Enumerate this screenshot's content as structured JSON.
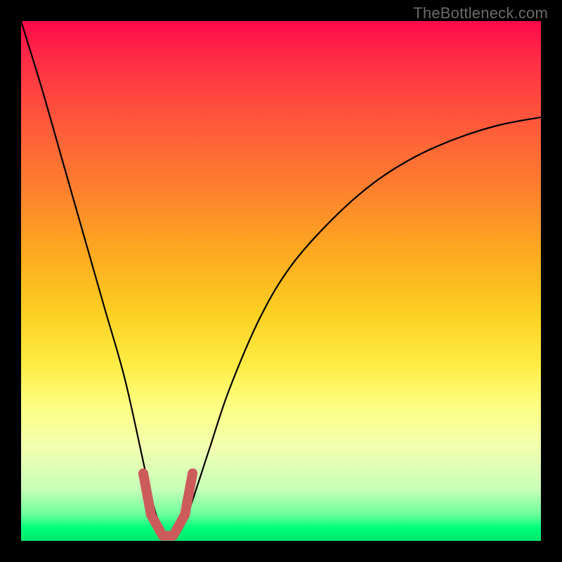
{
  "watermark": "TheBottleneck.com",
  "chart_data": {
    "type": "line",
    "title": "",
    "xlabel": "",
    "ylabel": "",
    "xlim": [
      0,
      100
    ],
    "ylim": [
      0,
      100
    ],
    "grid": false,
    "series": [
      {
        "name": "bottleneck-curve",
        "x": [
          0,
          4,
          8,
          12,
          16,
          20,
          24,
          26,
          28,
          30,
          32,
          36,
          40,
          46,
          52,
          60,
          68,
          76,
          84,
          92,
          100
        ],
        "y": [
          100,
          87,
          73,
          59,
          45,
          31,
          13,
          5,
          1,
          1,
          5,
          17,
          29,
          43,
          53,
          62,
          69,
          74,
          77.5,
          80,
          81.5
        ]
      }
    ],
    "annotations": [
      {
        "name": "bottleneck-region",
        "shape": "u-marker",
        "x_range": [
          23.5,
          33
        ],
        "y_min": 1
      }
    ],
    "gradient_background": {
      "direction": "vertical",
      "stops": [
        {
          "pos": 0,
          "color": "#ff0a4a"
        },
        {
          "pos": 0.5,
          "color": "#fccf22"
        },
        {
          "pos": 0.97,
          "color": "#00ff7a"
        },
        {
          "pos": 1.0,
          "color": "#00e66e"
        }
      ]
    }
  }
}
